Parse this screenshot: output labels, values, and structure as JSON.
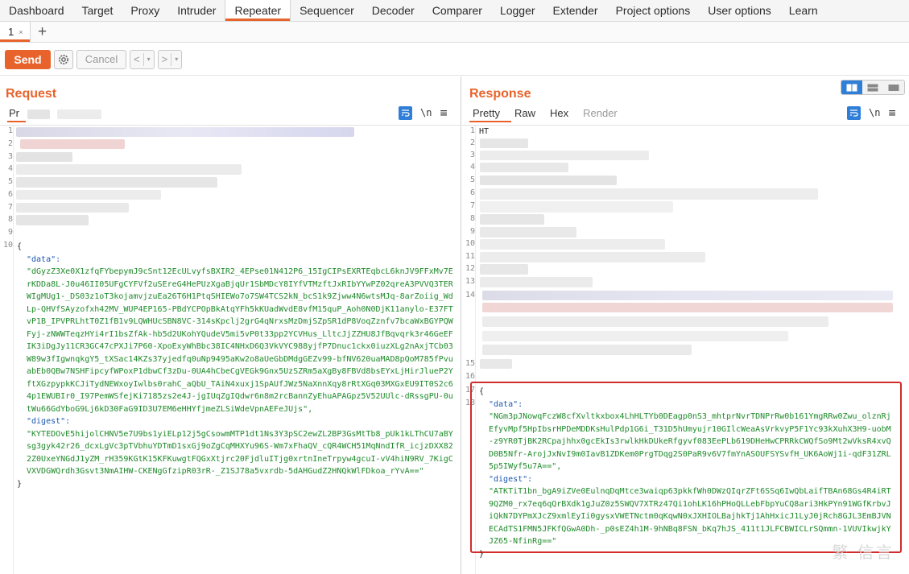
{
  "tool_tabs": [
    "Dashboard",
    "Target",
    "Proxy",
    "Intruder",
    "Repeater",
    "Sequencer",
    "Decoder",
    "Comparer",
    "Logger",
    "Extender",
    "Project options",
    "User options",
    "Learn"
  ],
  "active_tool_tab": "Repeater",
  "sub_tab": {
    "label": "1",
    "close": "×",
    "add": "+"
  },
  "toolbar": {
    "send_label": "Send",
    "cancel_label": "Cancel",
    "back_label": "<",
    "forward_label": ">",
    "dropdown_label": "▾"
  },
  "request": {
    "title": "Request",
    "view_tab_partial": "Pr",
    "newline_toggle": "\\n",
    "menu_icon": "≡",
    "line_numbers": [
      "1",
      "2",
      "3",
      "4",
      "5",
      "6",
      "7",
      "8",
      "9",
      "10"
    ],
    "body_open": "{",
    "data_key": "\"data\":",
    "data_value": "\"dGyzZ3Xe0X1zfqFYbepymJ9cSnt12EcULvyfsBXIR2_4EPse01N412P6_15IgCIPsEXRTEqbcL6knJV9FFxMv7ErKDDa8L-J0u46II05UFgCYFVf2uSEreG4HePUzXgaBjqUr1SbMDcY8IYfVTMzftJxRIbYYwPZ02qreA3PVVQ3TERWIgMUg1-_DS03z1oT3kojamvjzuEa26T6H1PtqSHIEWo7o7SW4TCS2kN_bcS1k9Zjww4N6wtsMJq-8arZoiig_WdLp-QHVfSAyzofxh42MV_WUP4EP165-PBdYCPOpBkAtqYFh5kKUadWvdE8vfM15quP_Aoh0N0DjK11anylo-E37FTvP1B_IPVPRLhtT0Z1fB1v9LQWHUcSBN8VC-314sKpclj2grG4qNrxsMzDmjSZpSR1dP8VoqZznfv7bcaWxBGYPQWFyj-zNWWTeqzHYi4rI1bsZfAk-hb5d2UKohYQudeV5mi5vP0t33pp2YCVHus_LltcJjZZHU8JfBqvqrk3r46GeEFIK3iDgJy11CR3GC47cPXJi7P60-XpoExyWhBbc38IC4NHxD6Q3VkVYC988yjfP7Dnuc1ckx0iuzXLg2nAxjTCb03W89w3fIgwnqkgY5_tXSac14KZs37yjedfq0uNp9495aKw2o8aUeGbDMdgGEZv99-bfNV620uaMAD8pQoM785fPvuabEb0QBw7NSHFipcyfWPoxP1dbwCf3zDu-0UA4hCbeCgVEGk9Gnx5UzSZRm5aXgBy8FBVd8bsEYxLjHirJlueP2YftXGzpypkKCJiTydNEWxoyIwlbs0rahC_aQbU_TAiN4xuxj1SpAUfJWz5NaXnnXqy8rRtXGq03MXGxEU9IT0S2c64p1EWUBIr0_I97PemWSfejKi7185zs2e4J-jgIUqZgIQdwr6n8m2rcBannZyEhuAPAGpz5V52UUlc-dRssgPU-0utWu66GdYboG9Lj6kD30FaG9ID3U7EM6eHHYfjmeZLSiWdeVpnAEFeJUjs\",",
    "digest_key": "\"digest\":",
    "digest_value": "\"KYTEDOvE5hijolCHNV5e7U9bs1yiELp12j5gCsowmMTP1dt1Ns3Y3pSC2ewZL2BP3GsMtTb8_pUk1kLThCU7aBYsg3gyk42r26_dcxLgVc3pTVbhuYDTmD1sxGj9oZgCqMHXYu96S-Wm7xFhaQV_cQR4WCH51MqNndIfR_icjzDXX822Z0UxeYNGdJ1yZM_rH359KGtK15KFKuwgtFQGxXtjrc20FjdluITjg0xrtnIneTrpyw4gcuI-vV4hiN9RV_7KigCVXVDGWQrdh3Gsvt3NmAIHW-CKENgGfzipR03rR-_Z1SJ78a5vxrdb-5dAHGudZ2HNQkWlFDkoa_rYvA==\"",
    "body_close": "}"
  },
  "response": {
    "title": "Response",
    "view_tabs": [
      "Pretty",
      "Raw",
      "Hex",
      "Render"
    ],
    "active_view_tab": "Pretty",
    "newline_toggle": "\\n",
    "menu_icon": "≡",
    "line_numbers": [
      "1",
      "2",
      "3",
      "4",
      "5",
      "6",
      "7",
      "8",
      "9",
      "10",
      "11",
      "12",
      "13",
      "14",
      "15",
      "16",
      "17",
      "18"
    ],
    "line1_partial": "HT",
    "body_open": "{",
    "data_key": "\"data\":",
    "data_value": "\"NGm3pJNowqFczW8cfXvltkxbox4LhHLTYb0DEagp0nS3_mhtprNvrTDNPrRw0b161YmgRRw0Zwu_olznRjEfyvMpf5HpIbsrHPDeMDDKsHulPdp1G6i_T31D5hUmyujr10GIlcWeaAsVrkvyP5F1Yc93kXuhX3H9-uobM-z9YR0TjBK2RCpajhhx0gcEkIs3rwlkHkDUkeRfgyvf083EePLb619DHeHwCPRRkCWQfSo9Mt2wVksR4xvQD0B5Nfr-ArojJxNvI9m0IavB1ZDKem0PrgTDqg2S0PaR9v6V7fmYnASOUFSYSvfH_UK6AoWj1i-qdF31ZRL5p5IWyf5u7A==\",",
    "digest_key": "\"digest\":",
    "digest_value": "\"ATKTiT1bn_bgA9iZVe0EulnqDqMtce3waiqp63pkkfWh0DWzQIqrZFt6SSq6IwQbLaifTBAn68Gs4R4iRT9QZM0_rx7eq6qQrBXdk1gJuZ0z5SWQV7XTRz47Qi1ohLK16hPHoQLLebFbpYuCQ8ari3HkPYn91WGfKrbvJiQkN7DYPmXJcZ9xmlEyIi0gysxVWETNctm0qKqwN0xJXHIOLBajhkTj1AhHxicJ1LyJ0jRch8GJL3EmBJVNECAdTS1FMN5JFKfQGwA0Dh-_p0sEZ4h1M-9hNBq8FSN_bKq7hJS_411t1JLFCBWICLrSQmmn-1VUVIkwjkYJZ65-NfinRg==\"",
    "body_close": "}"
  },
  "watermark": "繁 信言",
  "colors": {
    "accent": "#e8632b",
    "link_blue": "#2f7ed8",
    "json_key": "#1a56b0",
    "json_string": "#1e8a2a",
    "highlight": "#d42b2b"
  }
}
